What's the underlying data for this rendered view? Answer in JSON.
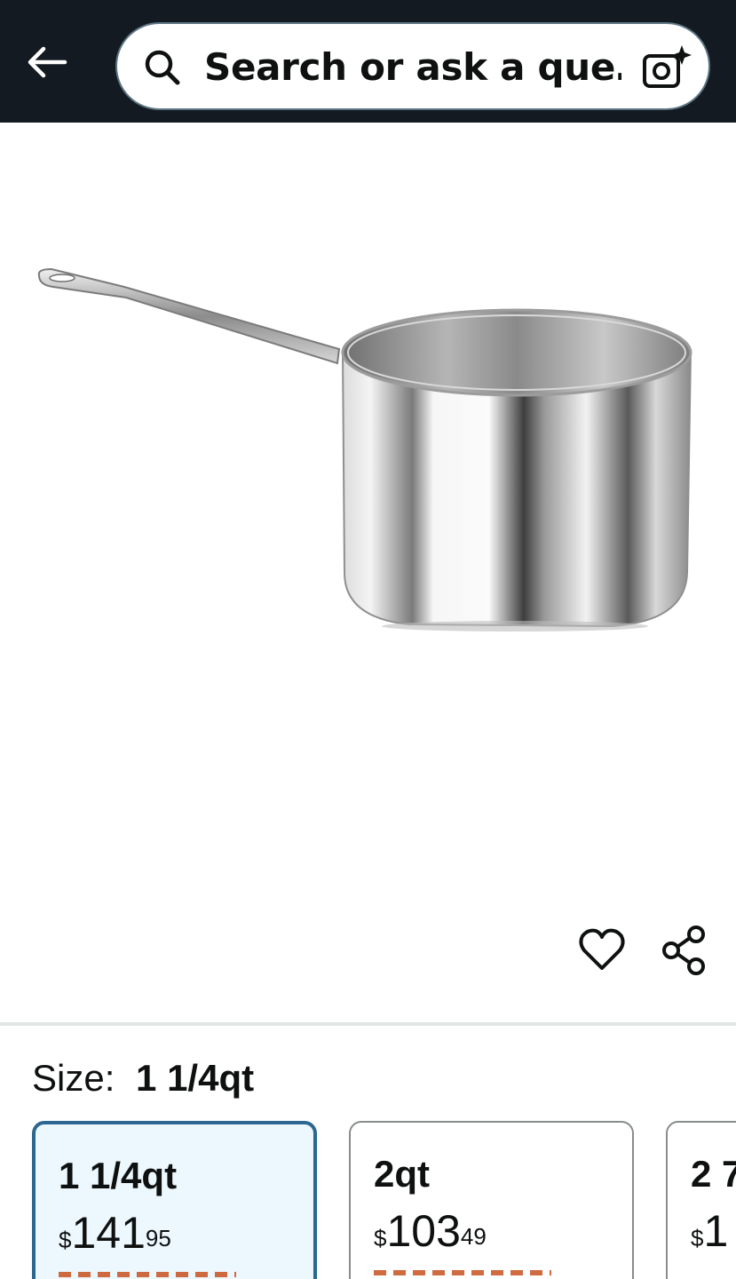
{
  "header": {
    "back_icon": "arrow-left-icon",
    "search": {
      "text": "Search or ask a que…",
      "icon": "search-icon",
      "camera_icon": "camera-sparkle-icon"
    }
  },
  "product": {
    "image": "stainless-steel-saucepan",
    "wishlist_icon": "heart-icon",
    "share_icon": "share-icon"
  },
  "size": {
    "label": "Size:",
    "selected": "1 1/4qt",
    "options": [
      {
        "title": "1 1/4qt",
        "currency": "$",
        "whole": "141",
        "fraction": "95",
        "selected": true
      },
      {
        "title": "2qt",
        "currency": "$",
        "whole": "103",
        "fraction": "49",
        "selected": false
      },
      {
        "title": "2 7",
        "currency": "$",
        "whole": "1",
        "fraction": "",
        "selected": false
      }
    ]
  },
  "colors": {
    "header_bg": "#131a22",
    "selected_border": "#2b6790",
    "selected_bg": "#edf8fe"
  }
}
